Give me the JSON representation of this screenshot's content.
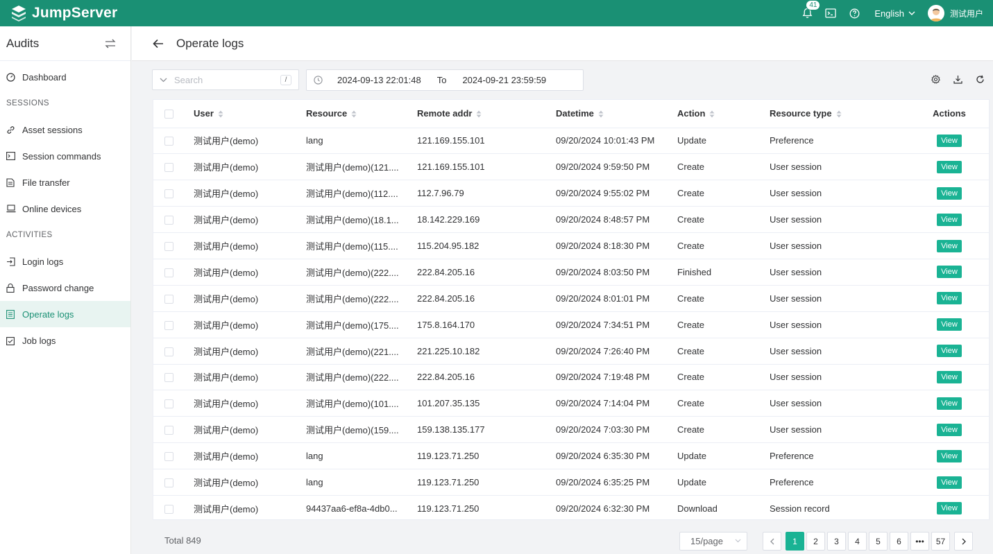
{
  "app": {
    "name": "JumpServer",
    "brand_color": "#1a9074",
    "accent_color": "#1ab394"
  },
  "topbar": {
    "notification_count": "41",
    "language": "English",
    "user_name": "测试用户"
  },
  "sidebar": {
    "title": "Audits",
    "dashboard": "Dashboard",
    "groups": [
      {
        "label": "SESSIONS",
        "items": [
          "Asset sessions",
          "Session commands",
          "File transfer",
          "Online devices"
        ]
      },
      {
        "label": "ACTIVITIES",
        "items": [
          "Login logs",
          "Password change",
          "Operate logs",
          "Job logs"
        ]
      }
    ],
    "active_item": "Operate logs"
  },
  "page": {
    "title": "Operate logs"
  },
  "toolbar": {
    "search_placeholder": "Search",
    "search_shortcut": "/",
    "date_start": "2024-09-13 22:01:48",
    "date_to": "To",
    "date_end": "2024-09-21 23:59:59"
  },
  "table": {
    "columns": [
      "User",
      "Resource",
      "Remote addr",
      "Datetime",
      "Action",
      "Resource type",
      "Actions"
    ],
    "view_label": "View",
    "rows": [
      {
        "user": "测试用户(demo)",
        "resource": "lang",
        "remote": "121.169.155.101",
        "datetime": "09/20/2024 10:01:43 PM",
        "action": "Update",
        "type": "Preference"
      },
      {
        "user": "测试用户(demo)",
        "resource": "测试用户(demo)(121....",
        "remote": "121.169.155.101",
        "datetime": "09/20/2024 9:59:50 PM",
        "action": "Create",
        "type": "User session"
      },
      {
        "user": "测试用户(demo)",
        "resource": "测试用户(demo)(112....",
        "remote": "112.7.96.79",
        "datetime": "09/20/2024 9:55:02 PM",
        "action": "Create",
        "type": "User session"
      },
      {
        "user": "测试用户(demo)",
        "resource": "测试用户(demo)(18.1...",
        "remote": "18.142.229.169",
        "datetime": "09/20/2024 8:48:57 PM",
        "action": "Create",
        "type": "User session"
      },
      {
        "user": "测试用户(demo)",
        "resource": "测试用户(demo)(115....",
        "remote": "115.204.95.182",
        "datetime": "09/20/2024 8:18:30 PM",
        "action": "Create",
        "type": "User session"
      },
      {
        "user": "测试用户(demo)",
        "resource": "测试用户(demo)(222....",
        "remote": "222.84.205.16",
        "datetime": "09/20/2024 8:03:50 PM",
        "action": "Finished",
        "type": "User session"
      },
      {
        "user": "测试用户(demo)",
        "resource": "测试用户(demo)(222....",
        "remote": "222.84.205.16",
        "datetime": "09/20/2024 8:01:01 PM",
        "action": "Create",
        "type": "User session"
      },
      {
        "user": "测试用户(demo)",
        "resource": "测试用户(demo)(175....",
        "remote": "175.8.164.170",
        "datetime": "09/20/2024 7:34:51 PM",
        "action": "Create",
        "type": "User session"
      },
      {
        "user": "测试用户(demo)",
        "resource": "测试用户(demo)(221....",
        "remote": "221.225.10.182",
        "datetime": "09/20/2024 7:26:40 PM",
        "action": "Create",
        "type": "User session"
      },
      {
        "user": "测试用户(demo)",
        "resource": "测试用户(demo)(222....",
        "remote": "222.84.205.16",
        "datetime": "09/20/2024 7:19:48 PM",
        "action": "Create",
        "type": "User session"
      },
      {
        "user": "测试用户(demo)",
        "resource": "测试用户(demo)(101....",
        "remote": "101.207.35.135",
        "datetime": "09/20/2024 7:14:04 PM",
        "action": "Create",
        "type": "User session"
      },
      {
        "user": "测试用户(demo)",
        "resource": "测试用户(demo)(159....",
        "remote": "159.138.135.177",
        "datetime": "09/20/2024 7:03:30 PM",
        "action": "Create",
        "type": "User session"
      },
      {
        "user": "测试用户(demo)",
        "resource": "lang",
        "remote": "119.123.71.250",
        "datetime": "09/20/2024 6:35:30 PM",
        "action": "Update",
        "type": "Preference"
      },
      {
        "user": "测试用户(demo)",
        "resource": "lang",
        "remote": "119.123.71.250",
        "datetime": "09/20/2024 6:35:25 PM",
        "action": "Update",
        "type": "Preference"
      },
      {
        "user": "测试用户(demo)",
        "resource": "94437aa6-ef8a-4db0...",
        "remote": "119.123.71.250",
        "datetime": "09/20/2024 6:32:30 PM",
        "action": "Download",
        "type": "Session record"
      }
    ]
  },
  "footer": {
    "total": "Total 849",
    "page_size": "15/page",
    "pages": [
      "1",
      "2",
      "3",
      "4",
      "5",
      "6",
      "•••",
      "57"
    ],
    "current_page": "1"
  }
}
